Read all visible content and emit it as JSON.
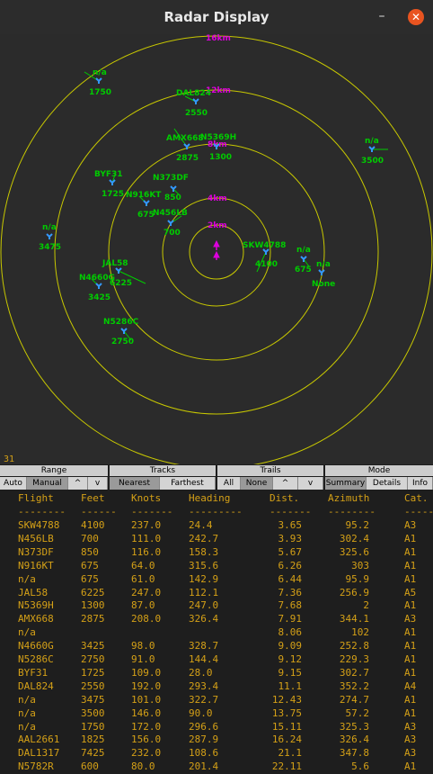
{
  "window": {
    "title": "Radar Display",
    "minimize": "–",
    "close": "✕"
  },
  "radar": {
    "counter": "31",
    "ring_labels": [
      "2km",
      "4km",
      "8km",
      "12km",
      "16km"
    ],
    "own_ship_color": "#dd00dd",
    "ring_color": "#c8c800",
    "target_color": "#00cc00",
    "symbol_color": "#3399ff",
    "targets": [
      {
        "id": "SKW4788",
        "alt": "4100"
      },
      {
        "id": "N456LB",
        "alt": "700"
      },
      {
        "id": "N373DF",
        "alt": "850"
      },
      {
        "id": "N916KT",
        "alt": "675"
      },
      {
        "id": "n/a",
        "alt": "675"
      },
      {
        "id": "JAL58",
        "alt": "6225"
      },
      {
        "id": "N5369H",
        "alt": "1300"
      },
      {
        "id": "AMX668",
        "alt": "2875"
      },
      {
        "id": "n/a",
        "alt": "None"
      },
      {
        "id": "N4660G",
        "alt": "3425"
      },
      {
        "id": "N5286C",
        "alt": "2750"
      },
      {
        "id": "BYF31",
        "alt": "1725"
      },
      {
        "id": "DAL824",
        "alt": "2550"
      },
      {
        "id": "n/a",
        "alt": "3475"
      },
      {
        "id": "n/a",
        "alt": "3500"
      },
      {
        "id": "n/a",
        "alt": "1750"
      }
    ]
  },
  "controls": {
    "range": {
      "label": "Range",
      "buttons": [
        "Auto",
        "Manual",
        "^",
        "v"
      ]
    },
    "tracks": {
      "label": "Tracks",
      "buttons": [
        "Nearest",
        "Farthest"
      ]
    },
    "trails": {
      "label": "Trails",
      "buttons": [
        "All",
        "None",
        "^",
        "v"
      ]
    },
    "mode": {
      "label": "Mode",
      "buttons": [
        "Summary",
        "Details",
        "Info"
      ]
    }
  },
  "table": {
    "headers": [
      "Flight",
      "Feet",
      "Knots",
      "Heading",
      "Dist.",
      "Azimuth",
      "Cat."
    ],
    "separators": [
      "--------",
      "------",
      "-------",
      "---------",
      "-------",
      "--------",
      "------"
    ],
    "rows": [
      [
        "SKW4788",
        "4100",
        "237.0",
        "24.4",
        "3.65",
        "95.2",
        "A3"
      ],
      [
        "N456LB",
        "700",
        "111.0",
        "242.7",
        "3.93",
        "302.4",
        "A1"
      ],
      [
        "N373DF",
        "850",
        "116.0",
        "158.3",
        "5.67",
        "325.6",
        "A1"
      ],
      [
        "N916KT",
        "675",
        "64.0",
        "315.6",
        "6.26",
        "303",
        "A1"
      ],
      [
        "n/a",
        "675",
        "61.0",
        "142.9",
        "6.44",
        "95.9",
        "A1"
      ],
      [
        "JAL58",
        "6225",
        "247.0",
        "112.1",
        "7.36",
        "256.9",
        "A5"
      ],
      [
        "N5369H",
        "1300",
        "87.0",
        "247.0",
        "7.68",
        "2",
        "A1"
      ],
      [
        "AMX668",
        "2875",
        "208.0",
        "326.4",
        "7.91",
        "344.1",
        "A3"
      ],
      [
        "n/a",
        "",
        "",
        "",
        "8.06",
        "102",
        "A1"
      ],
      [
        "N4660G",
        "3425",
        "98.0",
        "328.7",
        "9.09",
        "252.8",
        "A1"
      ],
      [
        "N5286C",
        "2750",
        "91.0",
        "144.4",
        "9.12",
        "229.3",
        "A1"
      ],
      [
        "BYF31",
        "1725",
        "109.0",
        "28.0",
        "9.15",
        "302.7",
        "A1"
      ],
      [
        "DAL824",
        "2550",
        "192.0",
        "293.4",
        "11.1",
        "352.2",
        "A4"
      ],
      [
        "n/a",
        "3475",
        "101.0",
        "322.7",
        "12.43",
        "274.7",
        "A1"
      ],
      [
        "n/a",
        "3500",
        "146.0",
        "90.0",
        "13.75",
        "57.2",
        "A1"
      ],
      [
        "n/a",
        "1750",
        "172.0",
        "296.6",
        "15.11",
        "325.3",
        "A3"
      ],
      [
        "AAL2661",
        "1825",
        "156.0",
        "287.9",
        "16.24",
        "326.4",
        "A3"
      ],
      [
        "DAL1317",
        "7425",
        "232.0",
        "108.6",
        "21.1",
        "347.8",
        "A3"
      ],
      [
        "N5782R",
        "600",
        "80.0",
        "201.4",
        "22.11",
        "5.6",
        "A1"
      ]
    ]
  }
}
